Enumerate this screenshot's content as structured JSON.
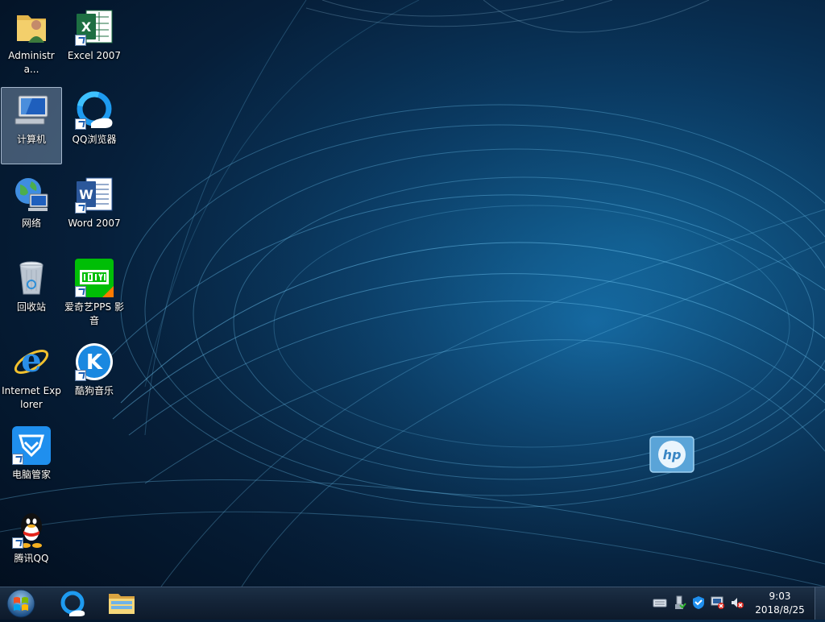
{
  "desktop": {
    "icons": [
      {
        "label": "Administra...",
        "icon": "user-folder-icon"
      },
      {
        "label": "Excel 2007",
        "icon": "excel-icon"
      },
      {
        "label": "计算机",
        "icon": "computer-icon"
      },
      {
        "label": "QQ浏览器",
        "icon": "qq-browser-icon"
      },
      {
        "label": "网络",
        "icon": "network-icon"
      },
      {
        "label": "Word 2007",
        "icon": "word-icon"
      },
      {
        "label": "回收站",
        "icon": "recycle-bin-icon"
      },
      {
        "label": "爱奇艺PPS 影音",
        "icon": "iqiyi-icon"
      },
      {
        "label": "Internet Explorer",
        "icon": "ie-icon"
      },
      {
        "label": "酷狗音乐",
        "icon": "kugou-icon"
      },
      {
        "label": "电脑管家",
        "icon": "pc-manager-icon"
      },
      {
        "label": "腾讯QQ",
        "icon": "qq-icon"
      }
    ],
    "wallpaper_logo": "hp"
  },
  "taskbar": {
    "clock_time": "9:03",
    "clock_date": "2018/8/25"
  },
  "colors": {
    "wallpaper_dark": "#061f3a",
    "wallpaper_light": "#1e8fd0",
    "taskbar": "#142438",
    "selection": "#b4cdeb"
  }
}
